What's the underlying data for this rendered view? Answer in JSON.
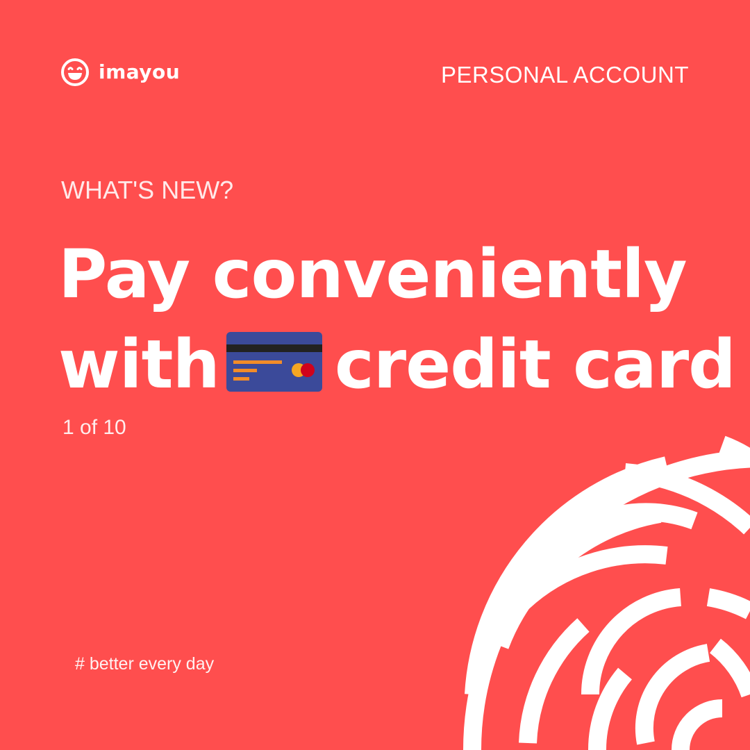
{
  "brand": {
    "name": "imayou",
    "icon": "laughing-face-icon"
  },
  "header": {
    "account_type": "PERSONAL ACCOUNT"
  },
  "content": {
    "eyebrow": "WHAT'S NEW?",
    "headline_line1": "Pay conveniently",
    "headline_line2_before": "with",
    "headline_line2_after": "credit card",
    "inline_icon": "credit-card-icon",
    "counter": "1 of 10"
  },
  "footer": {
    "hashtag": "# better every day"
  },
  "decoration": {
    "icon": "fingerprint-icon"
  },
  "colors": {
    "background": "#FF4E4E",
    "text": "#FFFFFF",
    "card_body": "#3B4A9A",
    "card_stripe": "#222222",
    "card_lines": "#F28C28",
    "card_chip_left": "#F5A623",
    "card_chip_right": "#D0021B"
  }
}
